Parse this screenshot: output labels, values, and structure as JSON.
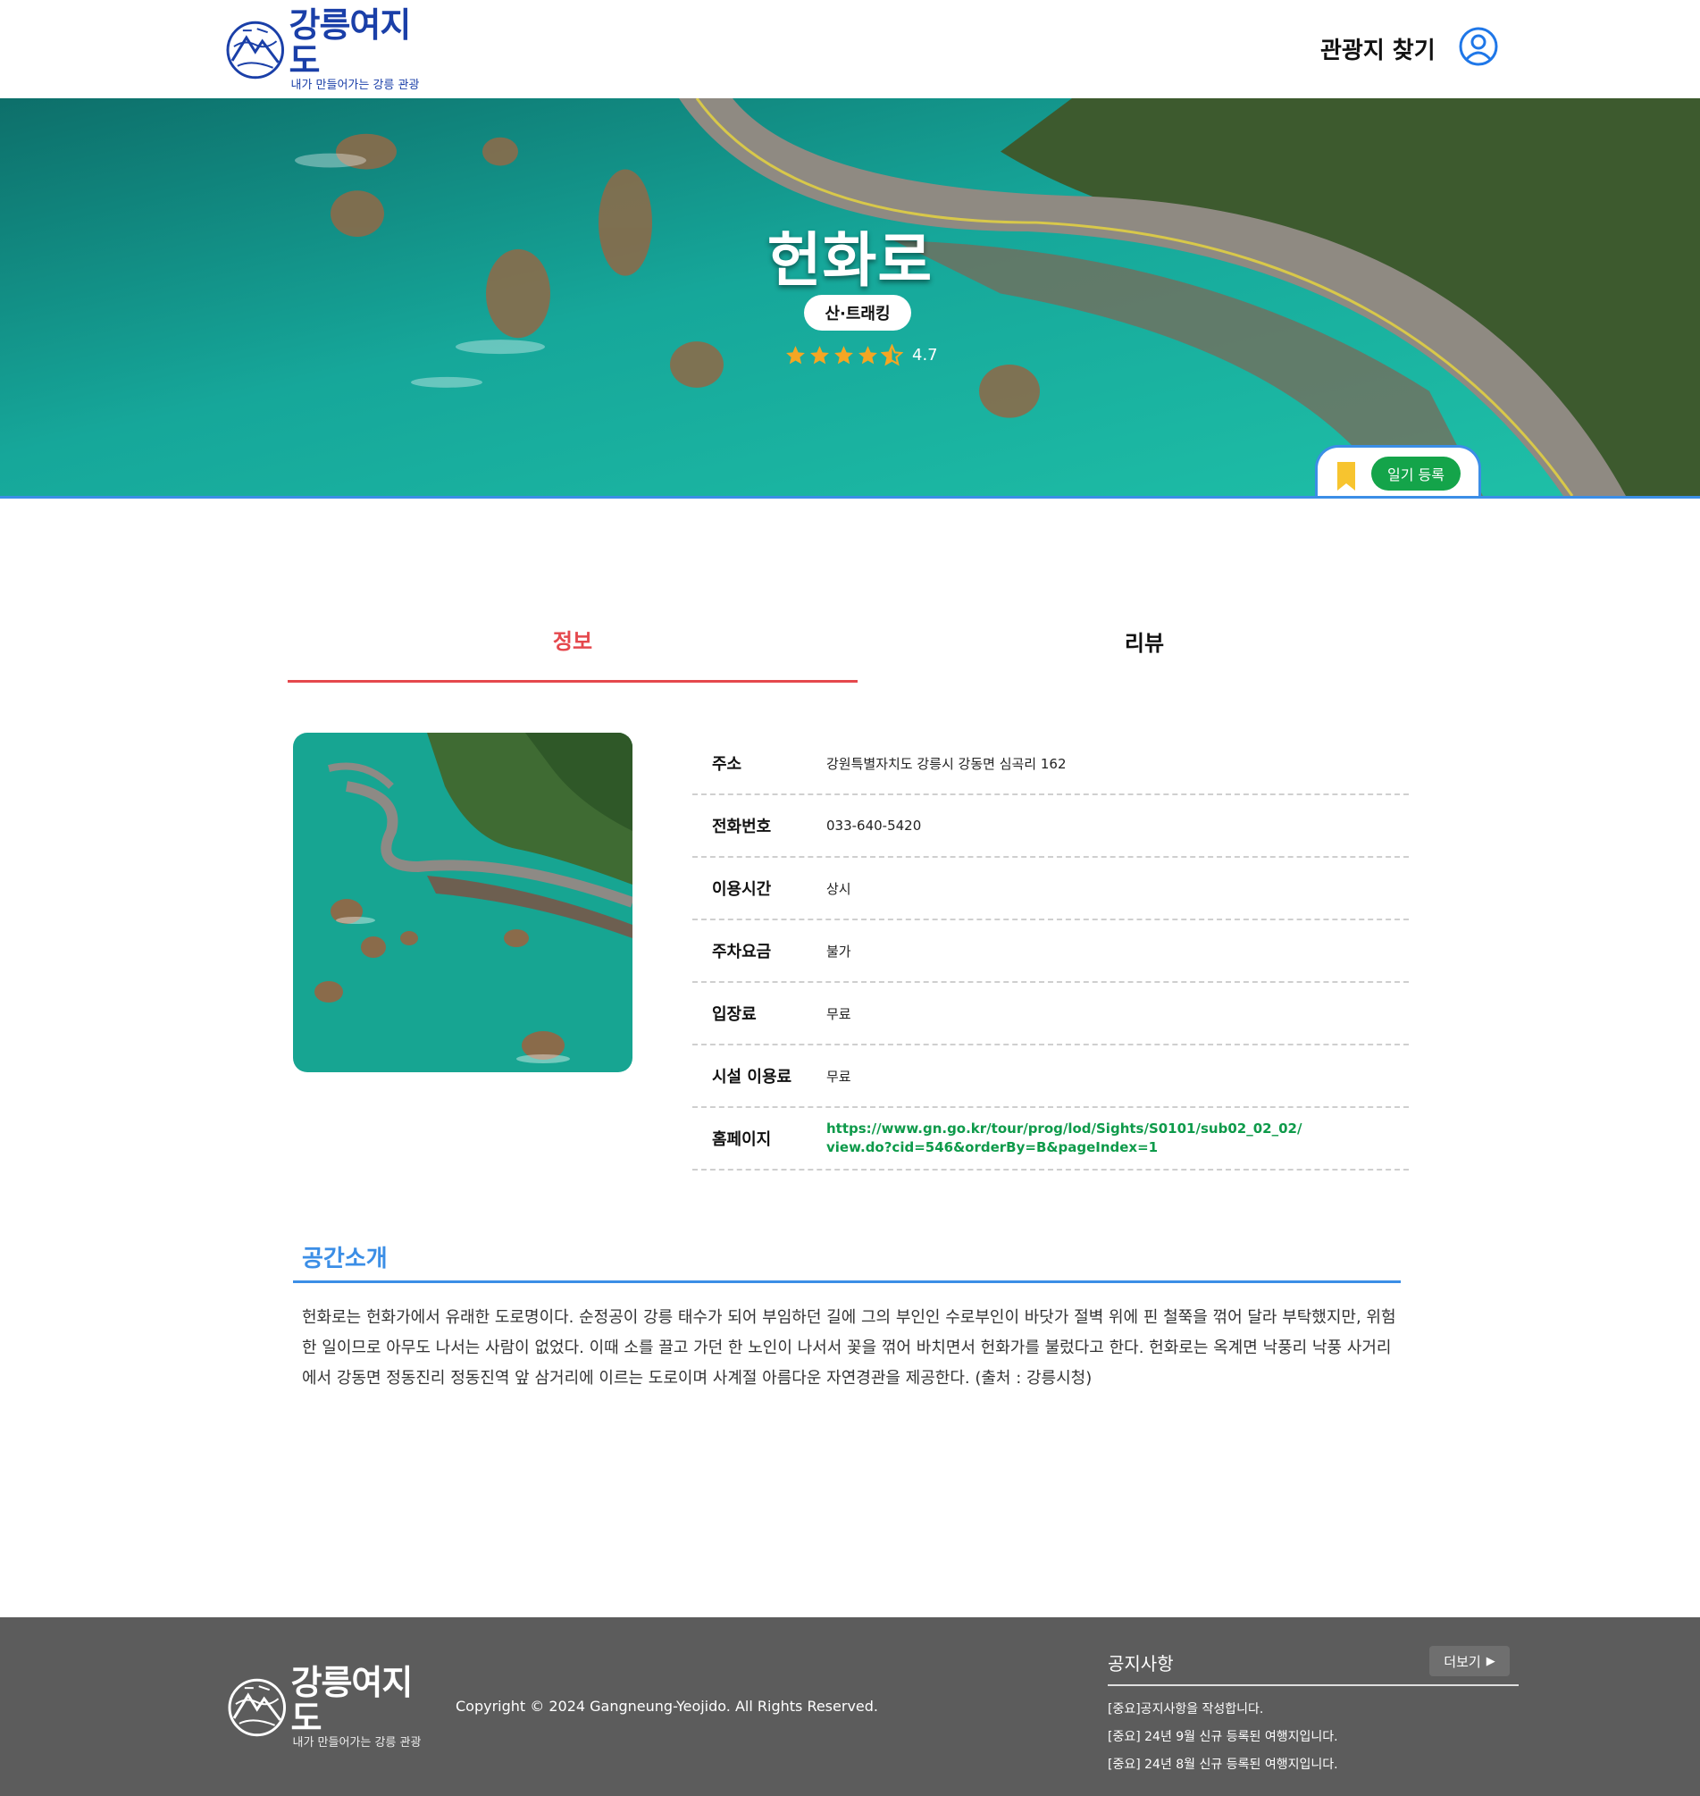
{
  "header": {
    "logo_title": "강릉여지도",
    "logo_subtitle": "내가 만들어가는 강릉 관광",
    "nav_find": "관광지 찾기"
  },
  "hero": {
    "title": "헌화로",
    "category": "산·트래킹",
    "rating": 4.7,
    "rating_text": "4.7",
    "diary_button": "일기 등록"
  },
  "tabs": [
    {
      "label": "정보",
      "active": true
    },
    {
      "label": "리뷰",
      "active": false
    }
  ],
  "info": [
    {
      "key": "주소",
      "value": "강원특별자치도 강릉시 강동면 심곡리 162"
    },
    {
      "key": "전화번호",
      "value": "033-640-5420"
    },
    {
      "key": "이용시간",
      "value": "상시"
    },
    {
      "key": "주차요금",
      "value": "불가"
    },
    {
      "key": "입장료",
      "value": "무료"
    },
    {
      "key": "시설 이용료",
      "value": "무료"
    },
    {
      "key": "홈페이지",
      "value": "https://www.gn.go.kr/tour/prog/lod/Sights/S0101/sub02_02_02/view.do?cid=546&orderBy=B&pageIndex=1"
    }
  ],
  "intro": {
    "title": "공간소개",
    "body": "헌화로는 헌화가에서 유래한 도로명이다. 순정공이 강릉 태수가 되어 부임하던 길에 그의 부인인 수로부인이 바닷가 절벽 위에 핀 철쭉을 꺾어 달라 부탁했지만, 위험한 일이므로 아무도 나서는 사람이 없었다. 이때 소를 끌고 가던 한 노인이 나서서 꽃을 꺾어 바치면서 헌화가를 불렀다고 한다. 헌화로는 옥계면 낙풍리 낙풍 사거리에서 강동면 정동진리 정동진역 앞 삼거리에 이르는 도로이며 사계절 아름다운 자연경관을 제공한다. (출처 : 강릉시청)"
  },
  "footer": {
    "logo_title": "강릉여지도",
    "logo_subtitle": "내가 만들어가는 강릉 관광",
    "copyright": "Copyright © 2024 Gangneung-Yeojido. All Rights Reserved.",
    "notice_title": "공지사항",
    "more_button": "더보기",
    "notices": [
      "[중요]공지사항을 작성합니다.",
      "[중요] 24년 9월 신규 등록된 여행지입니다.",
      "[중요] 24년 8월 신규 등록된 여행지입니다."
    ]
  },
  "colors": {
    "brand_blue": "#1a3fa8",
    "accent_blue": "#3b8ee6",
    "active_tab_red": "#e5484d",
    "link_green": "#0e9a4a",
    "diary_green": "#14a44a",
    "star_gold": "#f5a623",
    "footer_gray": "#5c5c5c"
  },
  "icons": {
    "logo": "logo-mountain-wave-icon",
    "user": "user-circle-icon",
    "star": "star-icon",
    "bookmark": "bookmark-icon",
    "more": "triangle-right-icon"
  }
}
